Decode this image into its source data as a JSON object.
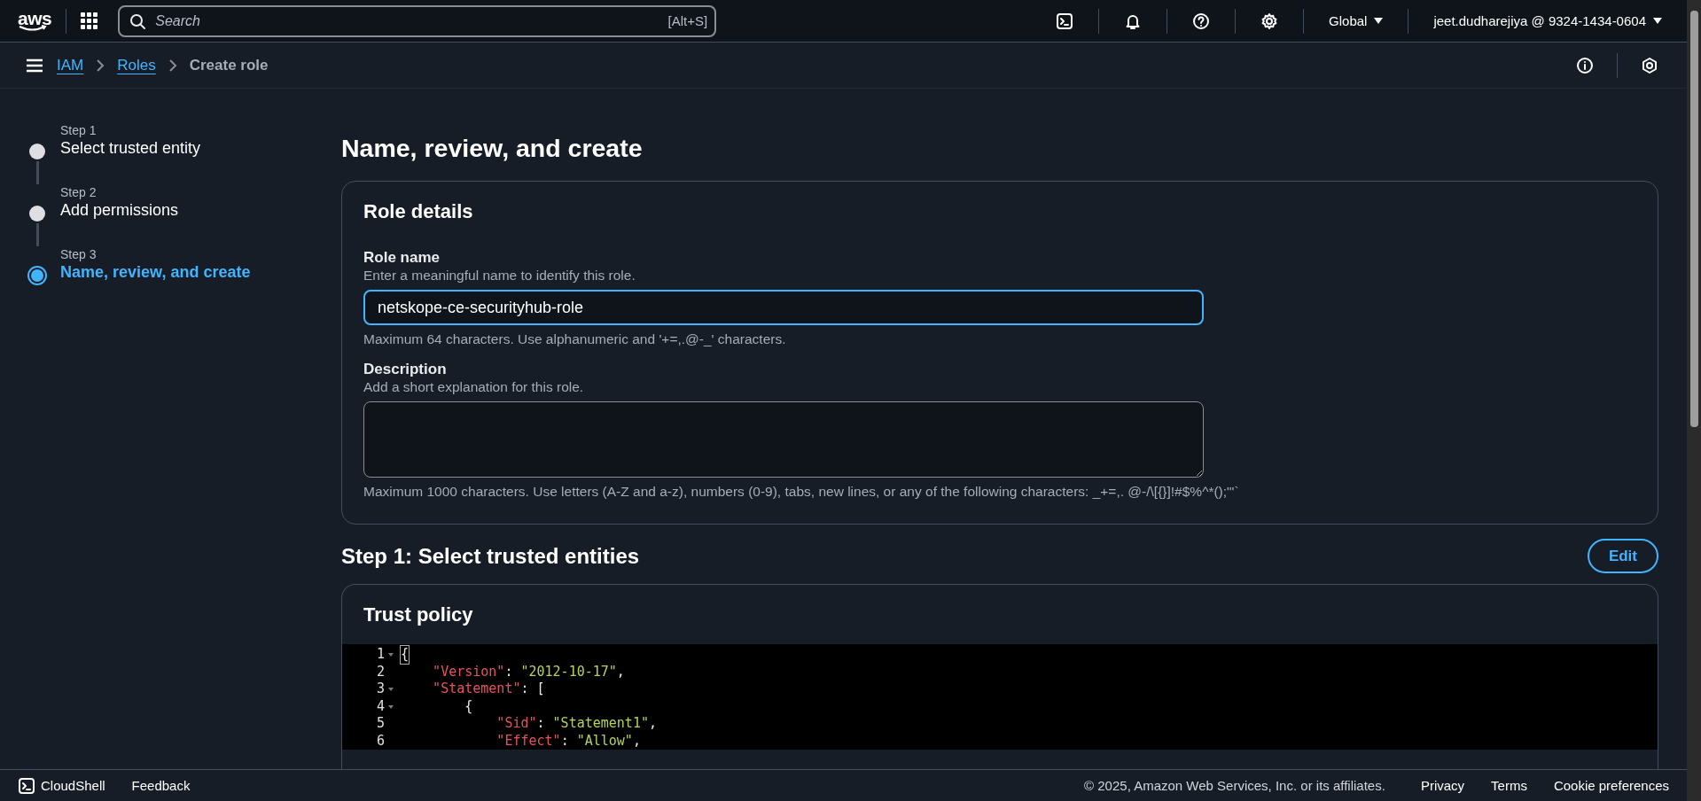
{
  "top_nav": {
    "logo": "aws",
    "search": {
      "placeholder": "Search",
      "shortcut": "[Alt+S]"
    },
    "region": "Global",
    "account": "jeet.dudharejiya @ 9324-1434-0604"
  },
  "breadcrumbs": [
    {
      "label": "IAM",
      "kind": "link"
    },
    {
      "label": "Roles",
      "kind": "link"
    },
    {
      "label": "Create role",
      "kind": "current"
    }
  ],
  "steps": [
    {
      "label": "Step 1",
      "title": "Select trusted entity",
      "selected": false
    },
    {
      "label": "Step 2",
      "title": "Add permissions",
      "selected": false
    },
    {
      "label": "Step 3",
      "title": "Name, review, and create",
      "selected": true
    }
  ],
  "page_title": "Name, review, and create",
  "role_details": {
    "title": "Role details",
    "fields": [
      {
        "kind": "input",
        "label": "Role name",
        "description": "Enter a meaningful name to identify this role.",
        "value": "netskope-ce-securityhub-role",
        "focused": true,
        "constraint": "Maximum 64 characters. Use alphanumeric and '+=,.@-_' characters."
      },
      {
        "kind": "textarea",
        "label": "Description",
        "description": "Add a short explanation for this role.",
        "focused": false,
        "constraint": "Maximum 1000 characters. Use letters (A-Z and a-z), numbers (0-9), tabs, new lines, or any of the following characters: _+=,. @-/\\[{}]!#$%^*();\"'`"
      }
    ]
  },
  "trusted_entities": {
    "title": "Step 1: Select trusted entities",
    "edit_button": "Edit",
    "card_title": "Trust policy",
    "code_lines": [
      {
        "number": "1",
        "fold": true,
        "tokens": [
          {
            "kind": "bracket",
            "text": "{"
          }
        ]
      },
      {
        "number": "2",
        "fold": false,
        "tokens": [
          {
            "kind": "key",
            "text": "    \"Version\""
          },
          {
            "kind": "punct",
            "text": ": "
          },
          {
            "kind": "string",
            "text": "\"2012-10-17\""
          },
          {
            "kind": "punct",
            "text": ","
          }
        ]
      },
      {
        "number": "3",
        "fold": true,
        "tokens": [
          {
            "kind": "key",
            "text": "    \"Statement\""
          },
          {
            "kind": "punct",
            "text": ": ["
          }
        ]
      },
      {
        "number": "4",
        "fold": true,
        "tokens": [
          {
            "kind": "punct",
            "text": "        {"
          }
        ]
      },
      {
        "number": "5",
        "fold": false,
        "tokens": [
          {
            "kind": "key",
            "text": "            \"Sid\""
          },
          {
            "kind": "punct",
            "text": ": "
          },
          {
            "kind": "string",
            "text": "\"Statement1\""
          },
          {
            "kind": "punct",
            "text": ","
          }
        ]
      },
      {
        "number": "6",
        "fold": false,
        "tokens": [
          {
            "kind": "key",
            "text": "            \"Effect\""
          },
          {
            "kind": "punct",
            "text": ": "
          },
          {
            "kind": "string",
            "text": "\"Allow\""
          },
          {
            "kind": "punct",
            "text": ","
          }
        ]
      }
    ]
  },
  "footer": {
    "cloudshell": "CloudShell",
    "feedback": "Feedback",
    "copyright": "© 2025, Amazon Web Services, Inc. or its affiliates.",
    "links": [
      "Privacy",
      "Terms",
      "Cookie preferences"
    ]
  }
}
